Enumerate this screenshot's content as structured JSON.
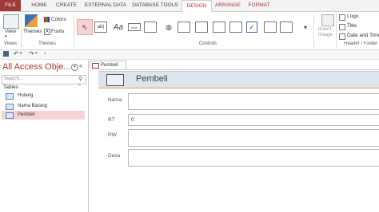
{
  "ribbon_tabs": [
    "FILE",
    "HOME",
    "CREATE",
    "EXTERNAL DATA",
    "DATABASE TOOLS",
    "DESIGN",
    "ARRANGE",
    "FORMAT"
  ],
  "ribbon": {
    "views": {
      "button": "View",
      "group": "Views"
    },
    "themes": {
      "button": "Themes",
      "colors": "Colors",
      "fonts": "Fonts",
      "group": "Themes"
    },
    "controls": {
      "group": "Controls",
      "textbox": "ab|",
      "label": "Aa",
      "button": "xxxx"
    },
    "insert_image": "Insert Image",
    "header_footer": {
      "logo": "Logo",
      "title": "Title",
      "date_time": "Date and Time",
      "group": "Header / Footer"
    }
  },
  "nav": {
    "title": "All Access Obje...",
    "search_placeholder": "Search...",
    "section": "Tables",
    "items": [
      {
        "label": "Hutang"
      },
      {
        "label": "Nama Barang"
      },
      {
        "label": "Pembeli"
      }
    ]
  },
  "document": {
    "tab_label": "Pembeli",
    "form_title": "Pembeli",
    "fields": [
      {
        "label": "Nama",
        "value": ""
      },
      {
        "label": "RT",
        "value": "0"
      },
      {
        "label": "RW",
        "value": ""
      },
      {
        "label": "Desa",
        "value": ""
      }
    ]
  },
  "colors": {
    "accent": "#a4373a",
    "selected": "#f6d2d3",
    "header_band": "#dde3ef",
    "header_border": "#e8a030"
  }
}
